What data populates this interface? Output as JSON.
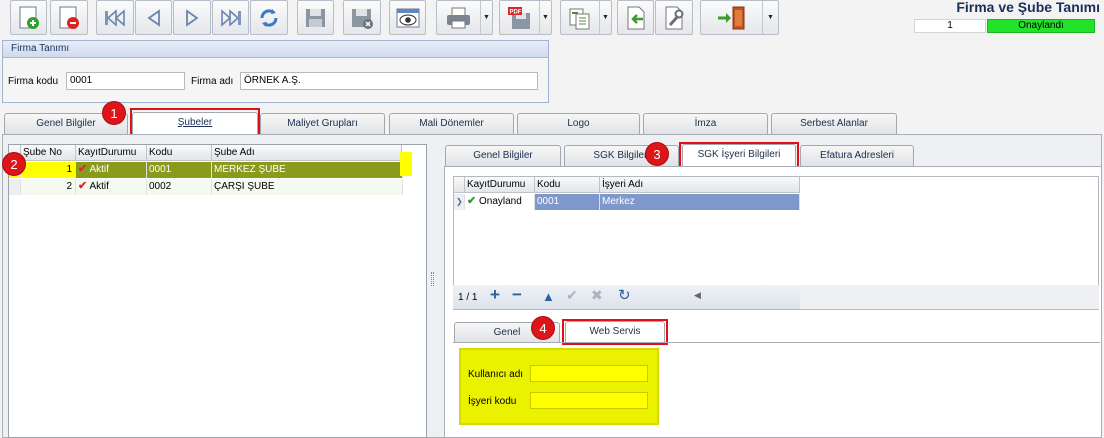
{
  "window": {
    "title": "Firma ve Şube Tanımı",
    "record_index": "1",
    "status": "Onaylandı"
  },
  "toolbar": [
    {
      "icon": "add-icon"
    },
    {
      "icon": "delete-icon"
    },
    {
      "icon": "first-record-icon"
    },
    {
      "icon": "previous-record-icon"
    },
    {
      "icon": "next-record-icon"
    },
    {
      "icon": "last-record-icon"
    },
    {
      "icon": "refresh-icon"
    },
    {
      "icon": "save-icon"
    },
    {
      "icon": "cancel-save-icon"
    },
    {
      "icon": "preview-icon"
    },
    {
      "icon": "print-icon"
    },
    {
      "icon": "pdf-export-icon"
    },
    {
      "icon": "export-icon"
    },
    {
      "icon": "import-icon"
    },
    {
      "icon": "tools-icon"
    },
    {
      "icon": "exit-icon"
    }
  ],
  "firma": {
    "group_title": "Firma Tanımı",
    "kod_label": "Firma kodu",
    "kod_value": "0001",
    "ad_label": "Firma adı",
    "ad_value": "ÖRNEK A.Ş."
  },
  "main_tabs": [
    "Genel Bilgiler",
    "Şubeler",
    "Maliyet Grupları",
    "Mali Dönemler",
    "Logo",
    "İmza",
    "Serbest Alanlar"
  ],
  "sube_grid": {
    "columns": [
      "Şube No",
      "KayıtDurumu",
      "Kodu",
      "Şube Adı"
    ],
    "rows": [
      {
        "no": "1",
        "durum": "Aktif",
        "kod": "0001",
        "ad": "MERKEZ ŞUBE"
      },
      {
        "no": "2",
        "durum": "Aktif",
        "kod": "0002",
        "ad": "ÇARŞI ŞUBE"
      }
    ]
  },
  "sub_tabs": [
    "Genel Bilgiler",
    "SGK Bilgileri",
    "SGK İşyeri Bilgileri",
    "Efatura Adresleri"
  ],
  "isyeri_grid": {
    "columns": [
      "KayıtDurumu",
      "Kodu",
      "İşyeri Adı"
    ],
    "rows": [
      {
        "durum": "Onayland",
        "kod": "0001",
        "ad": "Merkez"
      }
    ],
    "pager": "1 / 1"
  },
  "bottom_tabs": [
    "Genel",
    "Web Servis"
  ],
  "web_servis": {
    "kullanici_label": "Kullanıcı adı",
    "isyeri_label": "İşyeri kodu"
  },
  "badges": [
    "1",
    "2",
    "3",
    "4"
  ],
  "colors": {
    "status_green": "#22e22a",
    "highlight_yellow": "#ffff00",
    "selected_row": "#8a9a1c",
    "annotation_red": "#e0101a"
  }
}
